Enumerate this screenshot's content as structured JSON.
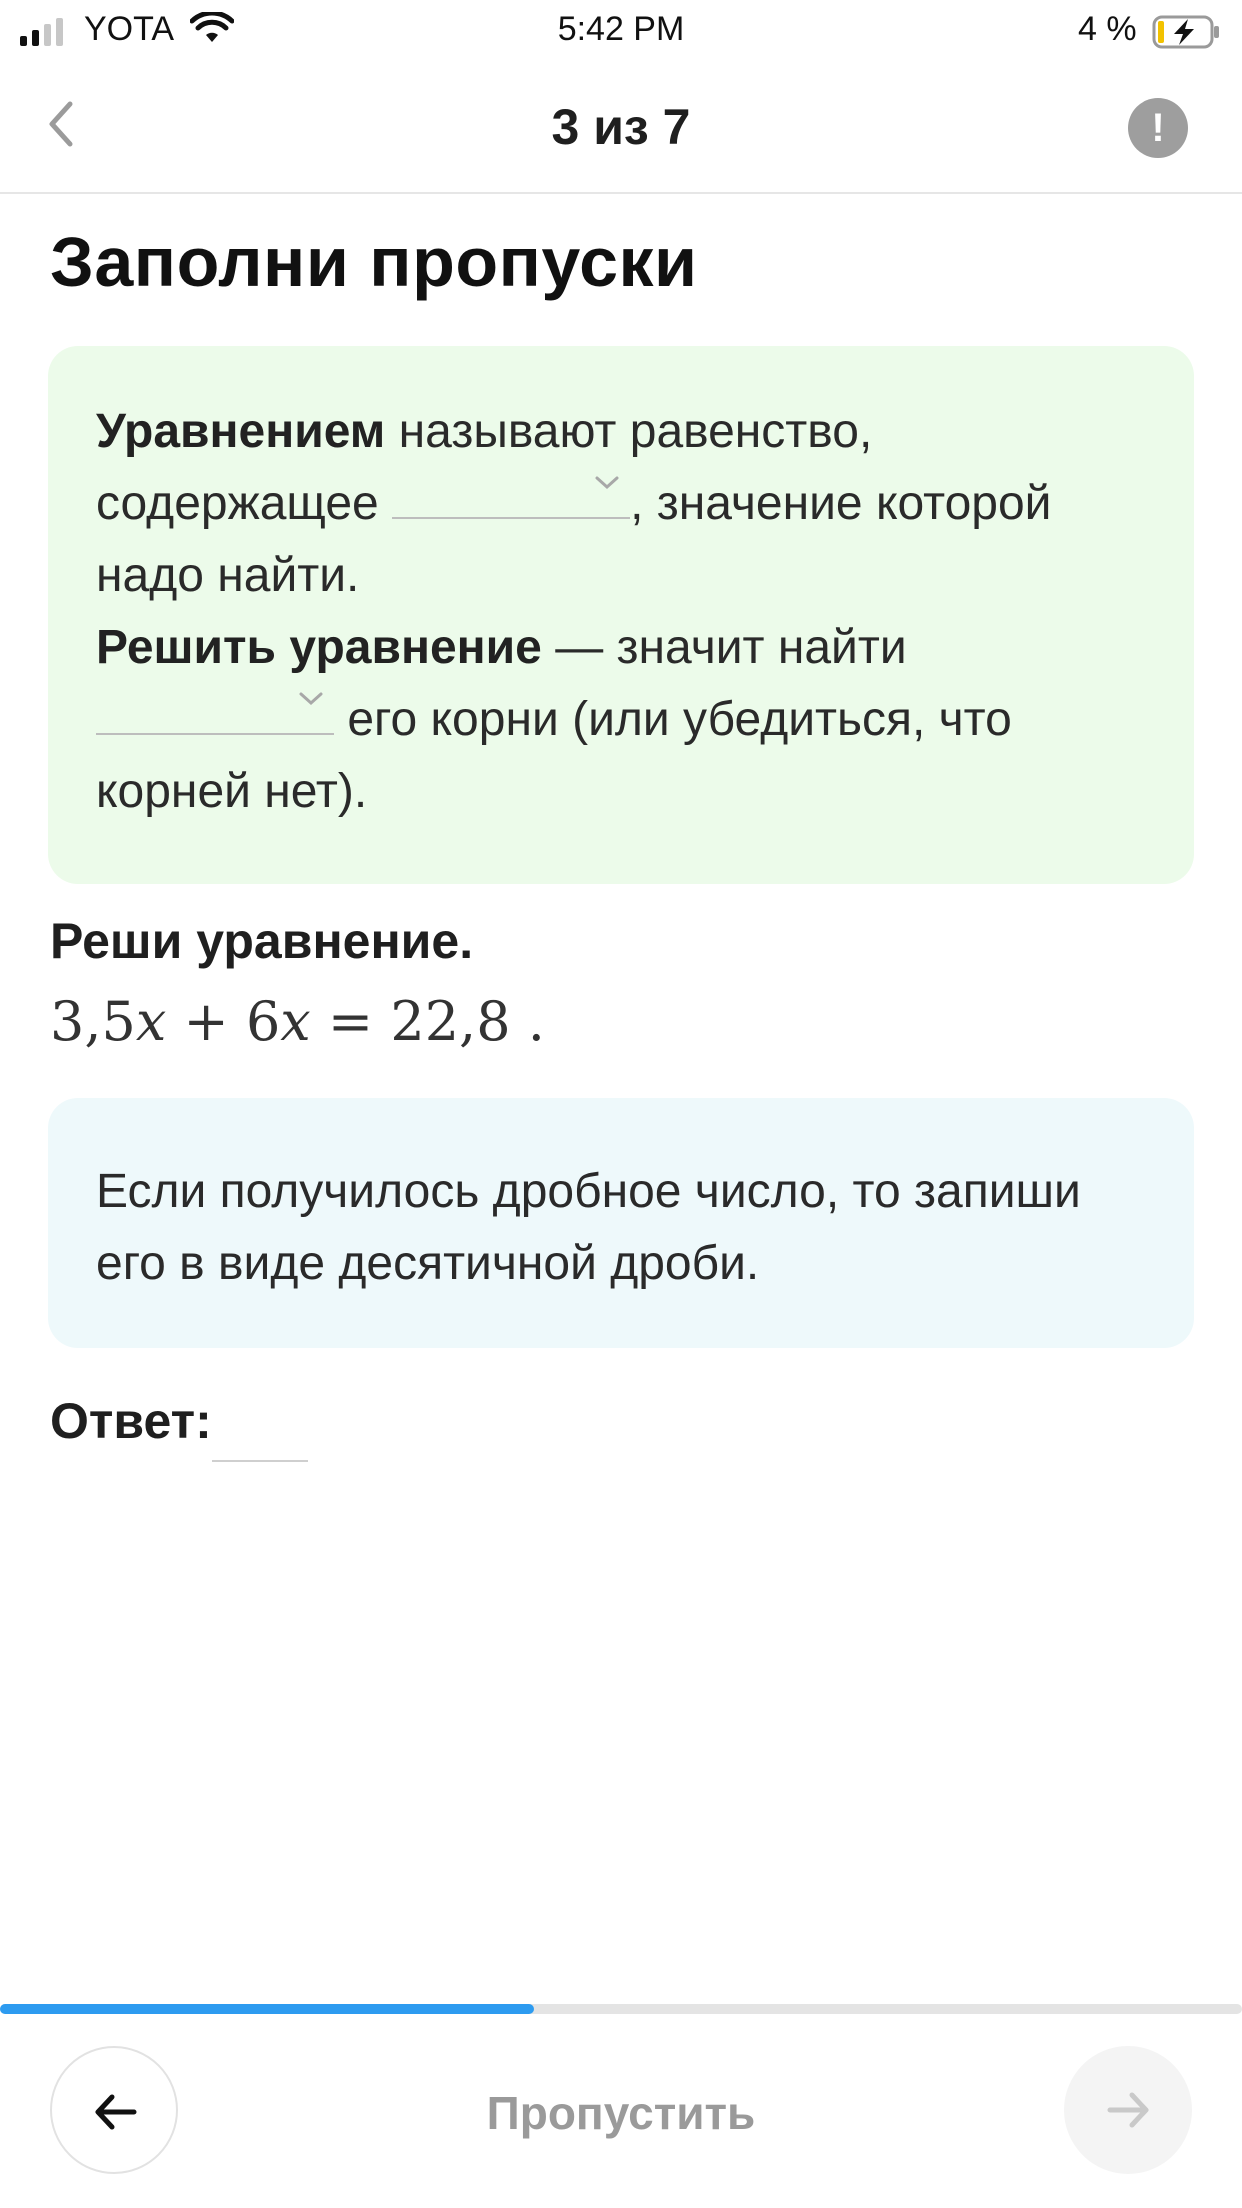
{
  "status_bar": {
    "carrier": "YOTA",
    "time": "5:42 PM",
    "battery_percent": "4 %",
    "signal_bars_active": 2
  },
  "nav": {
    "title": "3 из 7",
    "report_glyph": "!"
  },
  "heading": "Заполни пропуски",
  "theory": {
    "term1": "Уравнением",
    "text1": " называют равенство, содержащее ",
    "text2": ", значение которой надо найти.",
    "term2": "Решить уравнение",
    "text3": " — значит найти ",
    "text4": " его корни (или убедиться, что корней нет).",
    "blank1_value": "",
    "blank2_value": ""
  },
  "task": {
    "title": "Реши уравнение.",
    "eq_a": "3,5",
    "eq_plus": " + ",
    "eq_b": "6",
    "eq_var": "x",
    "eq_equals": " = ",
    "eq_rhs": "22,8",
    "eq_dot": " ."
  },
  "hint": "Если получилось дробное число, то запиши его в виде десятичной дроби.",
  "answer": {
    "label": "Ответ:",
    "value": ""
  },
  "progress": {
    "fraction": 0.43,
    "color": "#2d9bf0"
  },
  "footer": {
    "skip_label": "Пропустить"
  },
  "icons": {
    "back": "chevron-left-icon",
    "report": "exclamation-icon",
    "prev": "arrow-left-icon",
    "next": "arrow-right-icon"
  }
}
